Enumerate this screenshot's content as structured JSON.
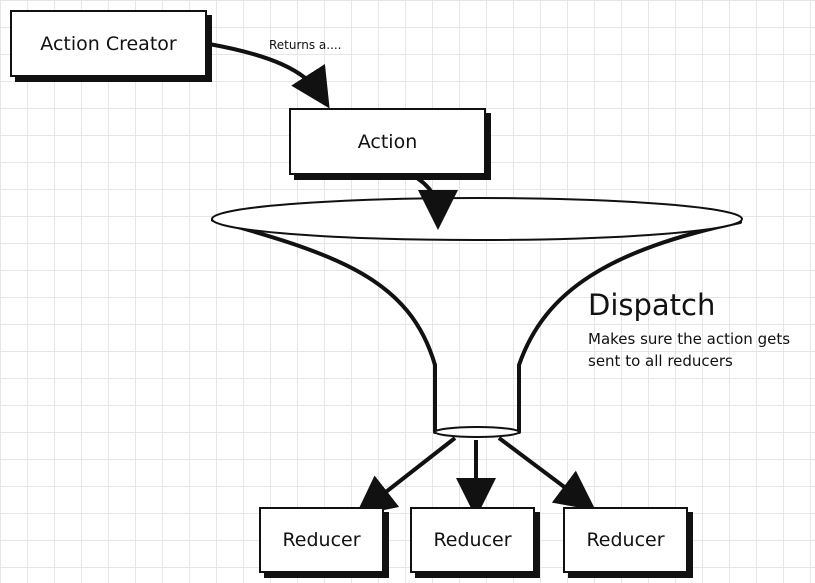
{
  "diagram": {
    "action_creator": "Action Creator",
    "returns_label": "Returns a....",
    "action": "Action",
    "dispatch_title": "Dispatch",
    "dispatch_description_line1": "Makes sure the action gets",
    "dispatch_description_line2": "sent to all reducers",
    "reducers": [
      "Reducer",
      "Reducer",
      "Reducer"
    ]
  }
}
